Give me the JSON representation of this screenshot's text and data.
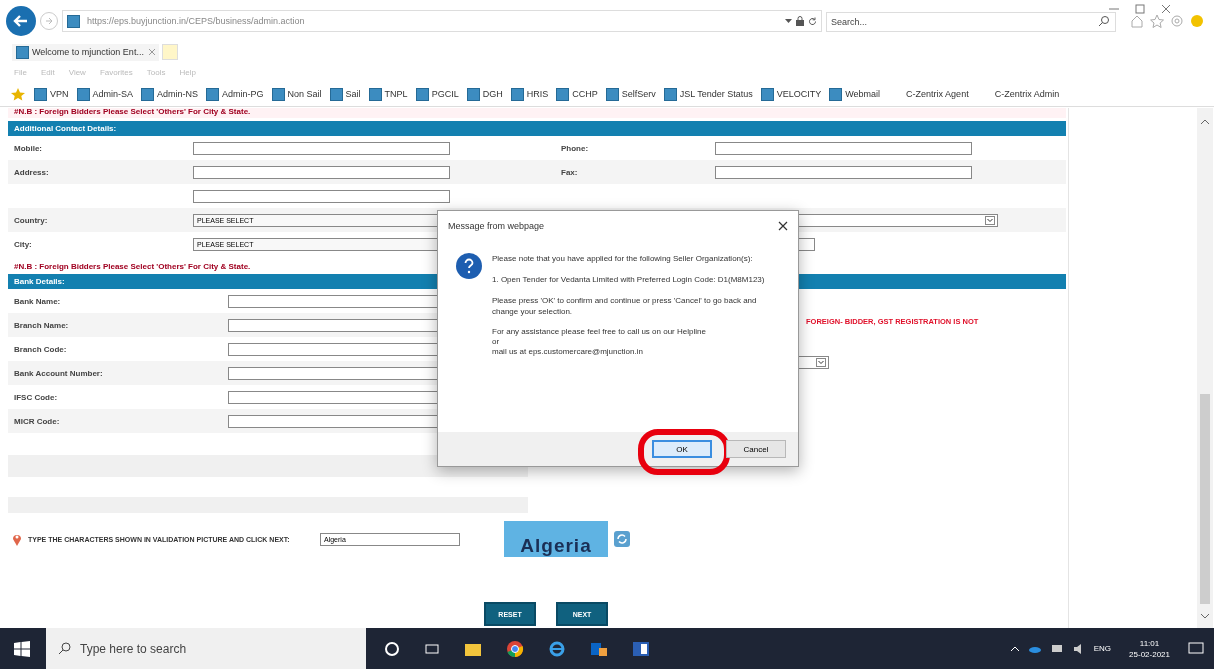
{
  "browser": {
    "url": "https://eps.buyjunction.in/CEPS/business/admin.action",
    "search_placeholder": "Search...",
    "tab_title": "Welcome to mjunction Ent...",
    "menu": [
      "File",
      "Edit",
      "View",
      "Favorites",
      "Tools",
      "Help"
    ],
    "favorites": [
      {
        "label": "VPN",
        "kind": "page"
      },
      {
        "label": "Admin-SA",
        "kind": "page"
      },
      {
        "label": "Admin-NS",
        "kind": "page"
      },
      {
        "label": "Admin-PG",
        "kind": "page"
      },
      {
        "label": "Non Sail",
        "kind": "page"
      },
      {
        "label": "Sail",
        "kind": "page"
      },
      {
        "label": "TNPL",
        "kind": "page"
      },
      {
        "label": "PGCIL",
        "kind": "page"
      },
      {
        "label": "DGH",
        "kind": "page"
      },
      {
        "label": "HRIS",
        "kind": "page"
      },
      {
        "label": "CCHP",
        "kind": "page"
      },
      {
        "label": "SelfServ",
        "kind": "page"
      },
      {
        "label": "JSL Tender Status",
        "kind": "page"
      },
      {
        "label": "VELOCITY",
        "kind": "page"
      },
      {
        "label": "Webmail",
        "kind": "page"
      },
      {
        "label": "C-Zentrix Agent",
        "kind": "text"
      },
      {
        "label": "C-Zentrix Admin",
        "kind": "text"
      }
    ]
  },
  "page": {
    "top_note": "#N.B : Foreign Bidders Please Select 'Others' For City & State.",
    "contact": {
      "title": "Additional Contact Details:",
      "rows": [
        {
          "label": "Mobile:",
          "field": {
            "kind": "input"
          },
          "right": {
            "label": "Phone:",
            "field": {
              "kind": "input"
            }
          }
        },
        {
          "label": "Address:",
          "field": {
            "kind": "input"
          },
          "right": {
            "label": "Fax:",
            "field": {
              "kind": "input"
            }
          }
        },
        {
          "field": {
            "kind": "input"
          }
        },
        {
          "label": "Country:",
          "field": {
            "kind": "select",
            "value": "PLEASE SELECT"
          },
          "right": {
            "field": {
              "kind": "select"
            }
          }
        },
        {
          "label": "City:",
          "field": {
            "kind": "select",
            "value": "PLEASE SELECT"
          },
          "right": {
            "field": {
              "kind": "small"
            }
          }
        }
      ]
    },
    "note": "#N.B : Foreign Bidders Please Select 'Others' For City & State.",
    "bank": {
      "title": "Bank Details:",
      "rows": [
        "Bank Name:",
        "Branch Name:",
        "Branch Code:",
        "Bank Account Number:",
        "IFSC Code:",
        "MICR Code:"
      ],
      "notice": "FOREIGN- BIDDER, GST REGISTRATION IS NOT"
    },
    "captcha": {
      "label": "TYPE THE CHARACTERS SHOWN IN VALIDATION PICTURE AND CLICK NEXT:",
      "value": "Algeria",
      "image_text": "Algeria"
    },
    "buttons": [
      "RESET",
      "NEXT"
    ]
  },
  "dialog": {
    "title": "Message from webpage",
    "paragraphs": [
      "Please note that you have applied for the following Seller Organization(s):",
      "1. Open Tender for Vedanta Limited with Preferred Login Code: D1(M8M123)",
      "Please press 'OK' to confirm and continue or press 'Cancel' to go back and change your selection."
    ],
    "help_lines": [
      "For any assistance please feel free to call us on our Helpline",
      "or",
      "mail us at eps.customercare@mjunction.in"
    ],
    "buttons": [
      {
        "label": "OK",
        "selected": true
      },
      {
        "label": "Cancel",
        "selected": false
      }
    ]
  },
  "taskbar": {
    "search_placeholder": "Type here to search",
    "language": "ENG",
    "time": "11:01",
    "date": "25-02-2021"
  }
}
